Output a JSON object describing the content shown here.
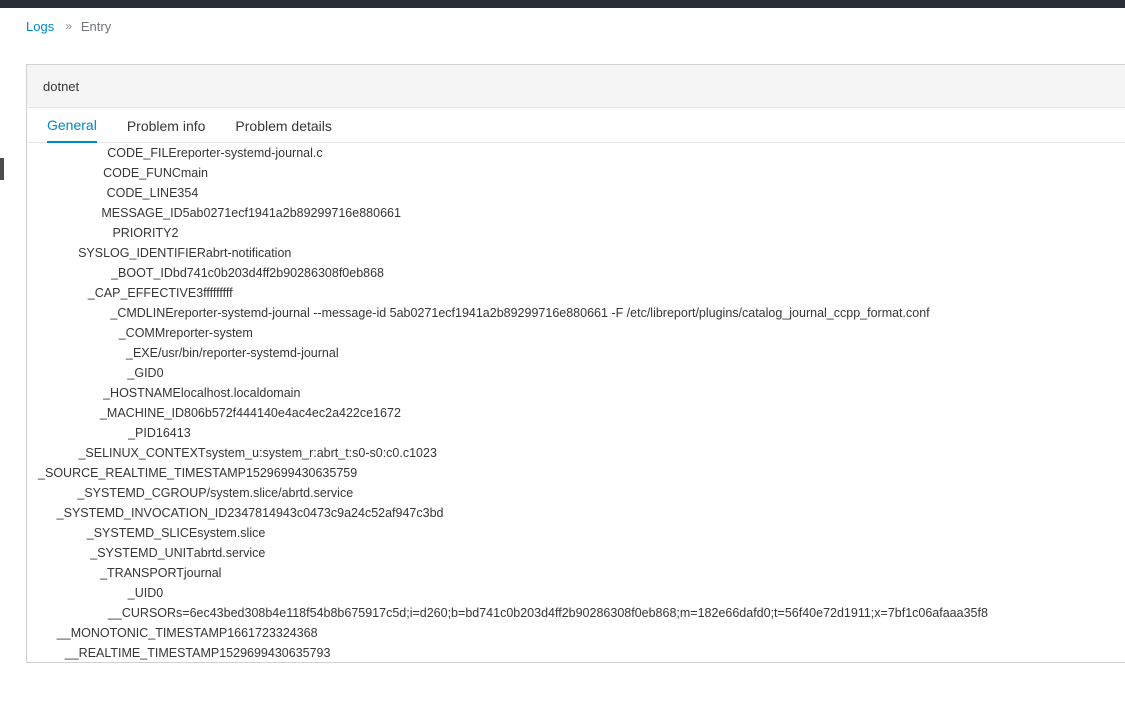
{
  "breadcrumb": {
    "parent": "Logs",
    "separator": "»",
    "current": "Entry"
  },
  "card": {
    "title": "dotnet"
  },
  "tabs": [
    {
      "label": "General",
      "active": true
    },
    {
      "label": "Problem info",
      "active": false
    },
    {
      "label": "Problem details",
      "active": false
    }
  ],
  "fields": [
    {
      "key": "CODE_FILE",
      "value": "reporter-systemd-journal.c"
    },
    {
      "key": "CODE_FUNC",
      "value": "main"
    },
    {
      "key": "CODE_LINE",
      "value": "354"
    },
    {
      "key": "MESSAGE_ID",
      "value": "5ab0271ecf1941a2b89299716e880661"
    },
    {
      "key": "PRIORITY",
      "value": "2"
    },
    {
      "key": "SYSLOG_IDENTIFIER",
      "value": "abrt-notification"
    },
    {
      "key": "_BOOT_ID",
      "value": "bd741c0b203d4ff2b90286308f0eb868"
    },
    {
      "key": "_CAP_EFFECTIVE",
      "value": "3fffffffff"
    },
    {
      "key": "_CMDLINE",
      "value": "reporter-systemd-journal --message-id 5ab0271ecf1941a2b89299716e880661 -F /etc/libreport/plugins/catalog_journal_ccpp_format.conf"
    },
    {
      "key": "_COMM",
      "value": "reporter-system"
    },
    {
      "key": "_EXE",
      "value": "/usr/bin/reporter-systemd-journal"
    },
    {
      "key": "_GID",
      "value": "0"
    },
    {
      "key": "_HOSTNAME",
      "value": "localhost.localdomain"
    },
    {
      "key": "_MACHINE_ID",
      "value": "806b572f444140e4ac4ec2a422ce1672"
    },
    {
      "key": "_PID",
      "value": "16413"
    },
    {
      "key": "_SELINUX_CONTEXT",
      "value": "system_u:system_r:abrt_t:s0-s0:c0.c1023"
    },
    {
      "key": "_SOURCE_REALTIME_TIMESTAMP",
      "value": "1529699430635759"
    },
    {
      "key": "_SYSTEMD_CGROUP",
      "value": "/system.slice/abrtd.service"
    },
    {
      "key": "_SYSTEMD_INVOCATION_ID",
      "value": "2347814943c0473c9a24c52af947c3bd"
    },
    {
      "key": "_SYSTEMD_SLICE",
      "value": "system.slice"
    },
    {
      "key": "_SYSTEMD_UNIT",
      "value": "abrtd.service"
    },
    {
      "key": "_TRANSPORT",
      "value": "journal"
    },
    {
      "key": "_UID",
      "value": "0"
    },
    {
      "key": "__CURSOR",
      "value": "s=6ec43bed308b4e118f54b8b675917c5d;i=d260;b=bd741c0b203d4ff2b90286308f0eb868;m=182e66dafd0;t=56f40e72d1911;x=7bf1c06afaaa35f8"
    },
    {
      "key": "__MONOTONIC_TIMESTAMP",
      "value": "1661723324368"
    },
    {
      "key": "__REALTIME_TIMESTAMP",
      "value": "1529699430635793"
    }
  ]
}
